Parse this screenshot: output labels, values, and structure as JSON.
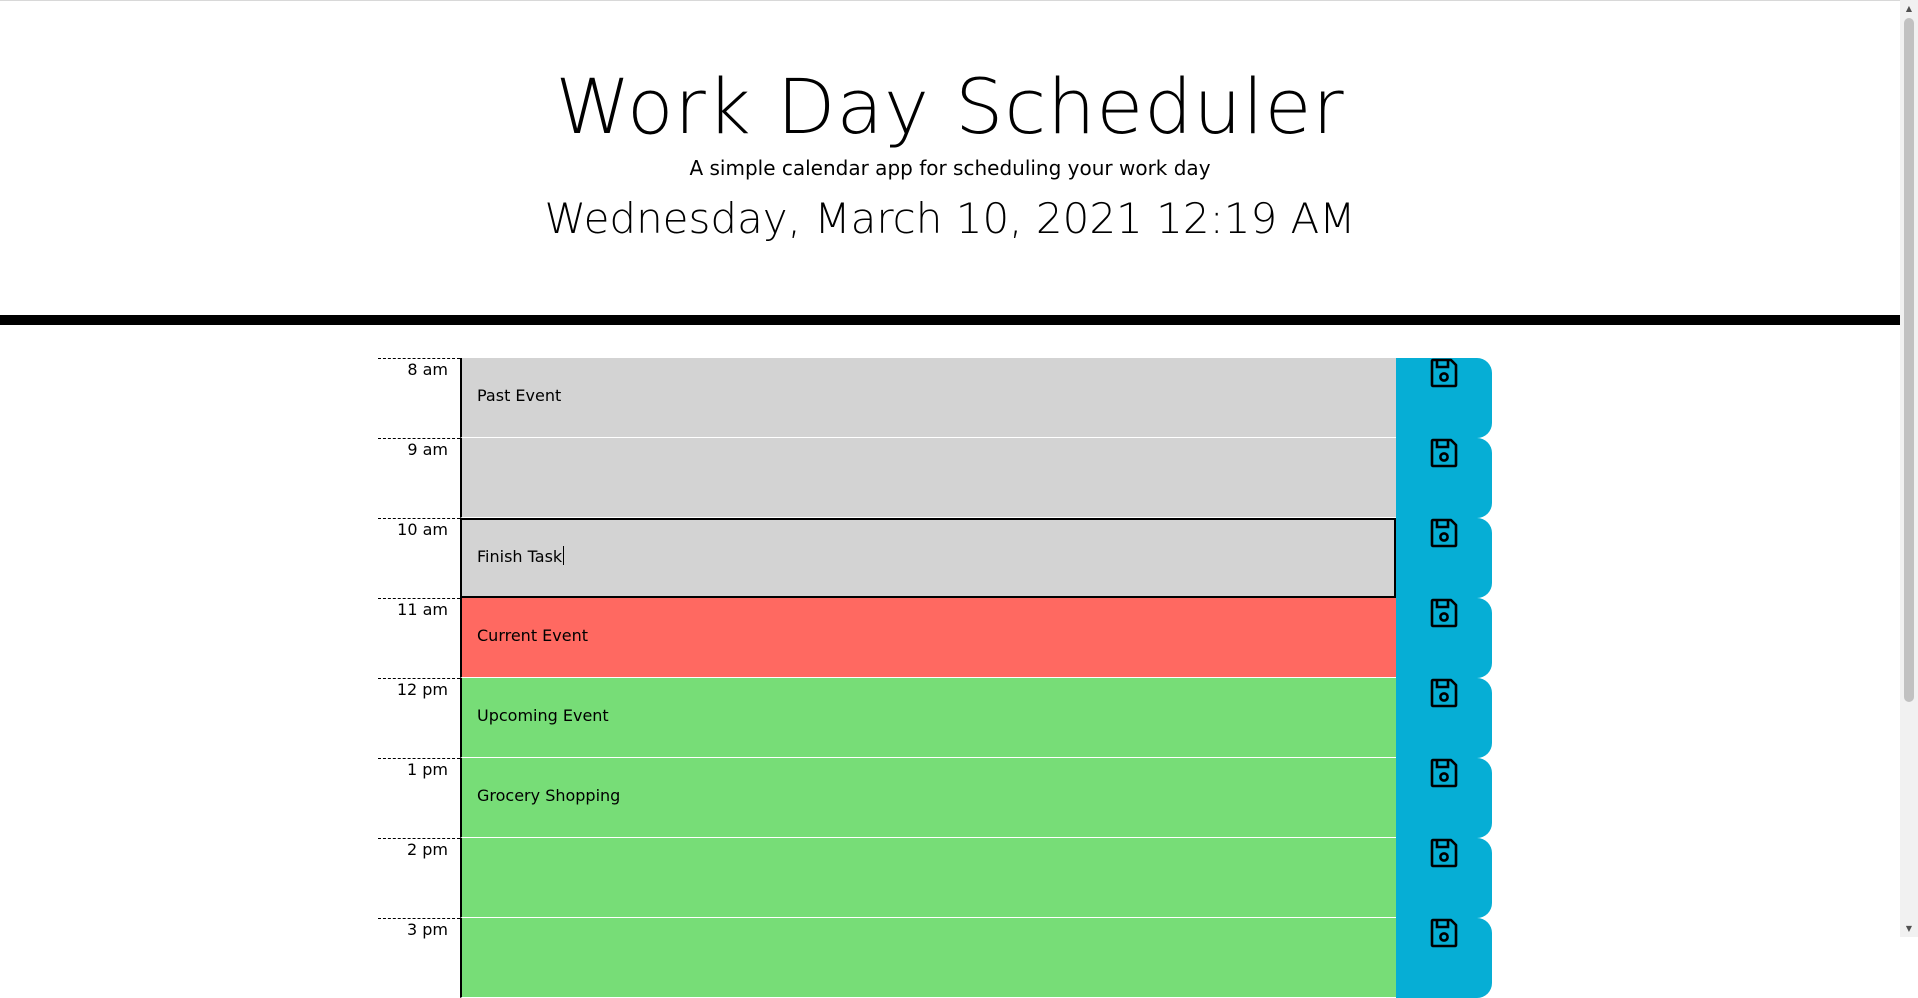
{
  "header": {
    "title": "Work Day Scheduler",
    "subtitle": "A simple calendar app for scheduling your work day",
    "current_day": "Wednesday, March 10, 2021 12:19 AM"
  },
  "colors": {
    "past": "#d3d3d3",
    "present": "#ff6961",
    "future": "#77dd77",
    "save_button": "#06aed5"
  },
  "time_blocks": [
    {
      "hour": "8 am",
      "text": "Past Event",
      "state": "past"
    },
    {
      "hour": "9 am",
      "text": "",
      "state": "past"
    },
    {
      "hour": "10 am",
      "text": "Finish Task",
      "state": "past"
    },
    {
      "hour": "11 am",
      "text": "Current Event",
      "state": "present"
    },
    {
      "hour": "12 pm",
      "text": "Upcoming Event",
      "state": "future"
    },
    {
      "hour": "1 pm",
      "text": "Grocery Shopping",
      "state": "future"
    },
    {
      "hour": "2 pm",
      "text": "",
      "state": "future"
    },
    {
      "hour": "3 pm",
      "text": "",
      "state": "future"
    }
  ],
  "save_icon": "floppy-disk-icon"
}
